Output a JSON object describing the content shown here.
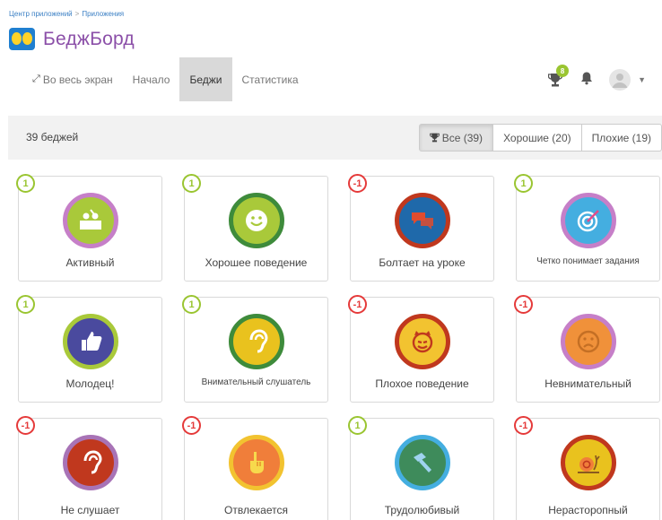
{
  "breadcrumb": {
    "parent": "Центр приложений",
    "separator": ">",
    "current": "Приложения"
  },
  "app": {
    "title": "БеджБорд"
  },
  "nav": {
    "fullscreen": "Во весь экран",
    "home": "Начало",
    "badges": "Беджи",
    "stats": "Статистика"
  },
  "top_icons": {
    "trophy_count": "8",
    "trophy_icon": "trophy-icon",
    "bell_icon": "bell-icon",
    "avatar_icon": "user-icon"
  },
  "toolbar": {
    "count_label": "39 беджей"
  },
  "filters": {
    "all": "Все (39)",
    "good": "Хорошие (20)",
    "bad": "Плохие (19)"
  },
  "badges": [
    {
      "points": "1",
      "name": "Активный",
      "ring": "#c67fc8",
      "fill": "#a9c93a",
      "icon": "presentation-icon"
    },
    {
      "points": "1",
      "name": "Хорошее поведение",
      "ring": "#3e8b3b",
      "fill": "#a9c93a",
      "icon": "smiley-icon"
    },
    {
      "points": "-1",
      "name": "Болтает на уроке",
      "ring": "#c0381e",
      "fill": "#1f69aa",
      "icon": "speech-bubbles-icon"
    },
    {
      "points": "1",
      "name": "Четко понимает задания",
      "ring": "#c67fc8",
      "fill": "#44aee0",
      "icon": "target-icon"
    },
    {
      "points": "1",
      "name": "Молодец!",
      "ring": "#a9c93a",
      "fill": "#4a4a9e",
      "icon": "thumbs-up-icon"
    },
    {
      "points": "1",
      "name": "Внимательный слушатель",
      "ring": "#3e8b3b",
      "fill": "#e9c21e",
      "icon": "ear-icon"
    },
    {
      "points": "-1",
      "name": "Плохое поведение",
      "ring": "#c0381e",
      "fill": "#f2c330",
      "icon": "devil-face-icon"
    },
    {
      "points": "-1",
      "name": "Невнимательный",
      "ring": "#c67fc8",
      "fill": "#f0913a",
      "icon": "sad-face-icon"
    },
    {
      "points": "-1",
      "name": "Не слушает",
      "ring": "#a873b6",
      "fill": "#c0381e",
      "icon": "ear-icon"
    },
    {
      "points": "-1",
      "name": "Отвлекается",
      "ring": "#f2c330",
      "fill": "#f07e3a",
      "icon": "pointing-hand-icon"
    },
    {
      "points": "1",
      "name": "Трудолюбивый",
      "ring": "#44aee0",
      "fill": "#3e8b5b",
      "icon": "hammer-icon"
    },
    {
      "points": "-1",
      "name": "Нерасторопный",
      "ring": "#c0381e",
      "fill": "#e9c21e",
      "icon": "snail-icon"
    }
  ],
  "colors": {
    "positive": "#9ac531",
    "negative": "#e53a3a",
    "title": "#8b4fa8",
    "link": "#3a7fc4"
  }
}
